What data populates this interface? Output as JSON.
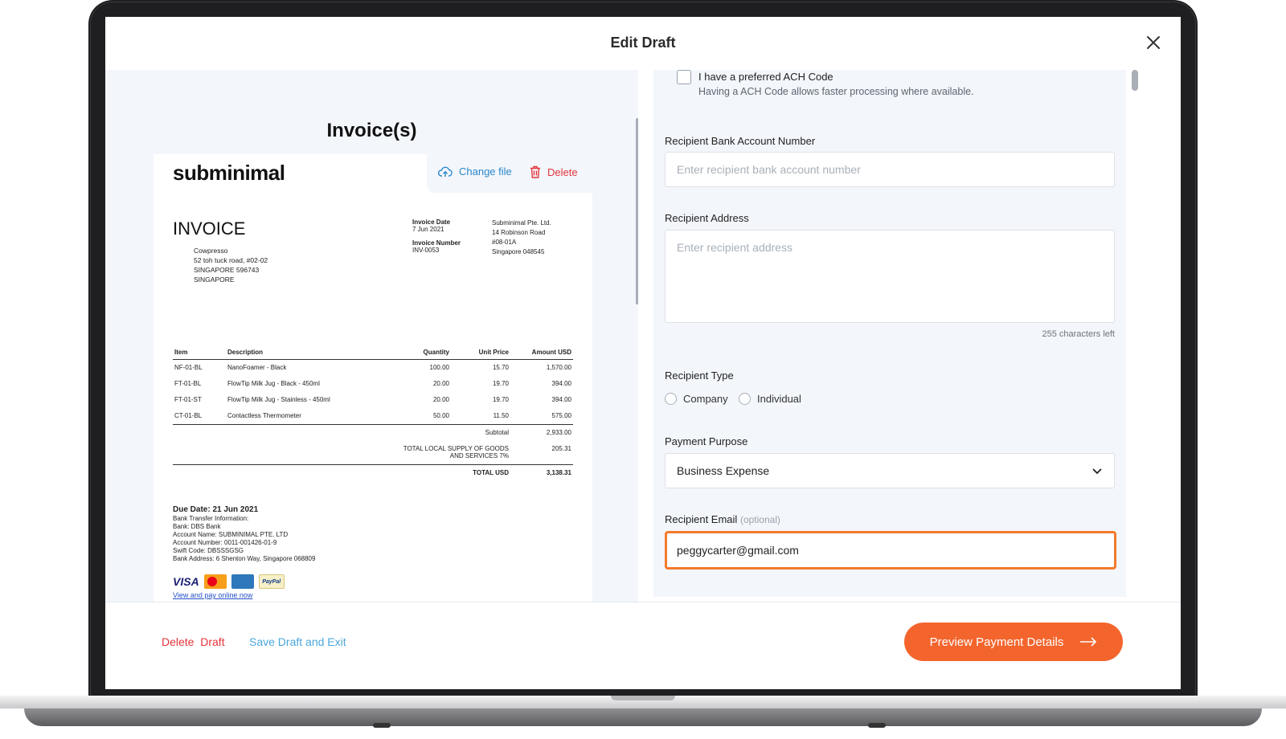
{
  "modal": {
    "title": "Edit Draft"
  },
  "invoice_panel": {
    "title": "Invoice(s)",
    "change_file_label": "Change file",
    "delete_label": "Delete"
  },
  "invoice": {
    "logo": "subminimal",
    "heading": "INVOICE",
    "bill_to": [
      "Cowpresso",
      "52 toh tuck road, #02-02",
      "SINGAPORE 596743",
      "SINGAPORE"
    ],
    "invoice_date_label": "Invoice Date",
    "invoice_date": "7 Jun 2021",
    "invoice_number_label": "Invoice Number",
    "invoice_number": "INV-0053",
    "from": [
      "Subminimal Pte. Ltd.",
      "14 Robinson Road",
      "#08-01A",
      "Singapore 048545"
    ],
    "columns": [
      "Item",
      "Description",
      "Quantity",
      "Unit Price",
      "Amount USD"
    ],
    "rows": [
      [
        "NF-01-BL",
        "NanoFoamer - Black",
        "100.00",
        "15.70",
        "1,570.00"
      ],
      [
        "FT-01-BL",
        "FlowTip Milk Jug - Black - 450ml",
        "20.00",
        "19.70",
        "394.00"
      ],
      [
        "FT-01-ST",
        "FlowTip Milk Jug - Stainless - 450ml",
        "20.00",
        "19.70",
        "394.00"
      ],
      [
        "CT-01-BL",
        "Contactless Thermometer",
        "50.00",
        "11.50",
        "575.00"
      ]
    ],
    "subtotal_label": "Subtotal",
    "subtotal": "2,933.00",
    "tax_label_1": "TOTAL LOCAL SUPPLY OF GOODS",
    "tax_label_2": "AND SERVICES 7%",
    "tax": "205.31",
    "total_label": "TOTAL USD",
    "total": "3,138.31",
    "due_date": "Due Date: 21 Jun 2021",
    "bank_lines": [
      "Bank Transfer Information:",
      "Bank: DBS Bank",
      "Account Name: SUBMINIMAL PTE. LTD",
      "Account Number: 0011-001426-01-9",
      "Swift Code: DBSSSGSG",
      "Bank Address: 6 Shenton Way, Singapore 068809"
    ],
    "card_visa": "VISA",
    "card_paypal": "PayPal",
    "pay_link": "View and pay online now"
  },
  "form": {
    "ach_label": "I have a preferred ACH Code",
    "ach_help": "Having a ACH Code allows faster processing where available.",
    "account_label": "Recipient Bank Account Number",
    "account_placeholder": "Enter recipient bank account number",
    "address_label": "Recipient Address",
    "address_placeholder": "Enter recipient address",
    "address_chars_left": "255 characters left",
    "type_label": "Recipient Type",
    "type_options": [
      "Company",
      "Individual"
    ],
    "purpose_label": "Payment Purpose",
    "purpose_value": "Business Expense",
    "email_label": "Recipient Email",
    "email_optional": "(optional)",
    "email_value": "peggycarter@gmail.com"
  },
  "footer": {
    "delete_draft": "Delete  Draft",
    "save_draft": "Save Draft and Exit",
    "preview": "Preview Payment Details"
  },
  "colors": {
    "accent": "#f3652d",
    "focus_border": "#f47a2b",
    "danger": "#e5343a",
    "link": "#4aa8dc",
    "panel_bg": "#f3f6fb"
  },
  "icons": [
    "close-icon",
    "cloud-upload-icon",
    "trash-icon",
    "chevron-down-icon",
    "arrow-right-icon"
  ]
}
